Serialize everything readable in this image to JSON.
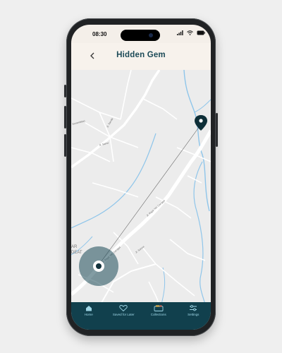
{
  "status": {
    "time": "08:30"
  },
  "header": {
    "title": "Hidden Gem",
    "back_icon": "chevron-left-icon"
  },
  "map": {
    "labels": {
      "road1": "Jl. Raya Yeh Gangga",
      "road2": "Jl. Raya Yeh Gangga",
      "road3": "Jl. Sanda",
      "road4": "Jl. Sanur",
      "road5": "Kerambitan",
      "road6": "Jl. Sanda",
      "place": "AR",
      "place2": "DEAT"
    }
  },
  "nav": {
    "items": [
      {
        "label": "Home",
        "icon": "home-icon"
      },
      {
        "label": "Saved for Later",
        "icon": "heart-icon"
      },
      {
        "label": "Collections",
        "icon": "collections-icon"
      },
      {
        "label": "Settings",
        "icon": "settings-icon"
      }
    ]
  },
  "colors": {
    "nav_bg": "#11404d",
    "accent": "#1c4a57",
    "water": "#8ec5ea"
  }
}
